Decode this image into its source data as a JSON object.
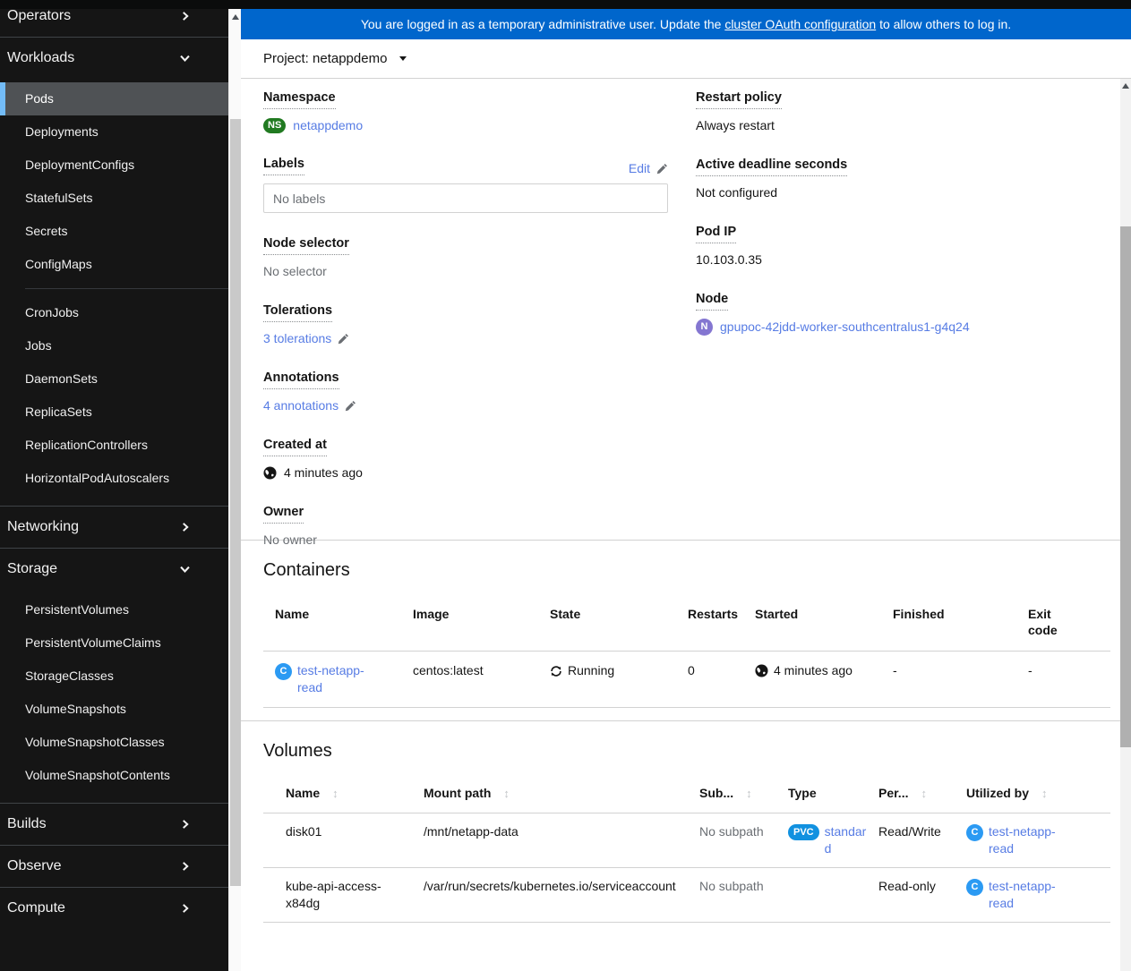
{
  "sidebar": {
    "sections": [
      {
        "label": "Operators",
        "chevron": "right"
      },
      {
        "label": "Workloads",
        "chevron": "down"
      },
      {
        "label": "Networking",
        "chevron": "right"
      },
      {
        "label": "Storage",
        "chevron": "down"
      },
      {
        "label": "Builds",
        "chevron": "right"
      },
      {
        "label": "Observe",
        "chevron": "right"
      },
      {
        "label": "Compute",
        "chevron": "right"
      }
    ],
    "workloads_items": [
      "Pods",
      "Deployments",
      "DeploymentConfigs",
      "StatefulSets",
      "Secrets",
      "ConfigMaps",
      "CronJobs",
      "Jobs",
      "DaemonSets",
      "ReplicaSets",
      "ReplicationControllers",
      "HorizontalPodAutoscalers"
    ],
    "storage_items": [
      "PersistentVolumes",
      "PersistentVolumeClaims",
      "StorageClasses",
      "VolumeSnapshots",
      "VolumeSnapshotClasses",
      "VolumeSnapshotContents"
    ],
    "selected_item": "Pods"
  },
  "banner": {
    "text_before": "You are logged in as a temporary administrative user. Update the ",
    "link_text": "cluster OAuth configuration",
    "text_after": " to allow others to log in."
  },
  "project_bar": {
    "label": "Project: netappdemo"
  },
  "details": {
    "namespace": {
      "label": "Namespace",
      "badge": "NS",
      "value": "netappdemo"
    },
    "labels": {
      "label": "Labels",
      "edit_label": "Edit",
      "placeholder": "No labels"
    },
    "node_selector": {
      "label": "Node selector",
      "value": "No selector"
    },
    "tolerations": {
      "label": "Tolerations",
      "link_text": "3 tolerations"
    },
    "annotations": {
      "label": "Annotations",
      "link_text": "4 annotations"
    },
    "created_at": {
      "label": "Created at",
      "value": "4 minutes ago"
    },
    "owner": {
      "label": "Owner",
      "value": "No owner"
    },
    "restart_policy": {
      "label": "Restart policy",
      "value": "Always restart"
    },
    "active_deadline_seconds": {
      "label": "Active deadline seconds",
      "value": "Not configured"
    },
    "pod_ip": {
      "label": "Pod IP",
      "value": "10.103.0.35"
    },
    "node": {
      "label": "Node",
      "badge": "N",
      "value": "gpupoc-42jdd-worker-southcentralus1-g4q24"
    }
  },
  "containers": {
    "heading": "Containers",
    "columns": [
      "Name",
      "Image",
      "State",
      "Restarts",
      "Started",
      "Finished",
      "Exit code"
    ],
    "rows": [
      {
        "badge": "C",
        "name": "test-netapp-read",
        "image": "centos:latest",
        "state": "Running",
        "restarts": "0",
        "started": "4 minutes ago",
        "finished": "-",
        "exit_code": "-"
      }
    ]
  },
  "volumes": {
    "heading": "Volumes",
    "columns": [
      {
        "label": "Name",
        "sortable": true
      },
      {
        "label": "Mount path",
        "sortable": true
      },
      {
        "label": "Sub...",
        "sortable": true
      },
      {
        "label": "Type",
        "sortable": false
      },
      {
        "label": "Per...",
        "sortable": true
      },
      {
        "label": "Utilized by",
        "sortable": true
      }
    ],
    "rows": [
      {
        "name": "disk01",
        "mount_path": "/mnt/netapp-data",
        "subpath": "No subpath",
        "type_badge": "PVC",
        "type_link": "standard",
        "permissions": "Read/Write",
        "utilized_badge": "C",
        "utilized_by": "test-netapp-read"
      },
      {
        "name": "kube-api-access-x84dg",
        "mount_path": "/var/run/secrets/kubernetes.io/serviceaccount",
        "subpath": "No subpath",
        "type_badge": "",
        "type_link": "",
        "permissions": "Read-only",
        "utilized_badge": "C",
        "utilized_by": "test-netapp-read"
      }
    ]
  },
  "colors": {
    "banner_background": "#0066cc",
    "link": "#577ce4",
    "namespace_badge": "#217a21",
    "container_badge": "#2b9af3",
    "node_badge": "#8476d1",
    "pvc_badge": "#1191e0",
    "sidebar_background": "#151515",
    "sidebar_selected_background": "#4f5255",
    "sidebar_selected_border": "#73bcf7"
  }
}
